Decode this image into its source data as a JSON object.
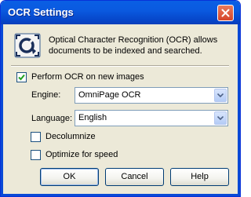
{
  "window": {
    "title": "OCR Settings",
    "close_icon": "close-x-icon",
    "app_icon": "ocr-scan-icon"
  },
  "description": "Optical Character Recognition (OCR) allows documents to be indexed and searched.",
  "perform_ocr": {
    "label": "Perform OCR on new images",
    "checked": true
  },
  "engine": {
    "label": "Engine:",
    "value": "OmniPage OCR"
  },
  "language": {
    "label": "Language:",
    "value": "English"
  },
  "decolumnize": {
    "label": "Decolumnize",
    "checked": false
  },
  "optimize": {
    "label": "Optimize for speed",
    "checked": false
  },
  "buttons": {
    "ok": "OK",
    "cancel": "Cancel",
    "help": "Help"
  },
  "colors": {
    "titlebar": "#0a5ae0",
    "dialog_bg": "#ece9d8",
    "close": "#d6452a"
  }
}
